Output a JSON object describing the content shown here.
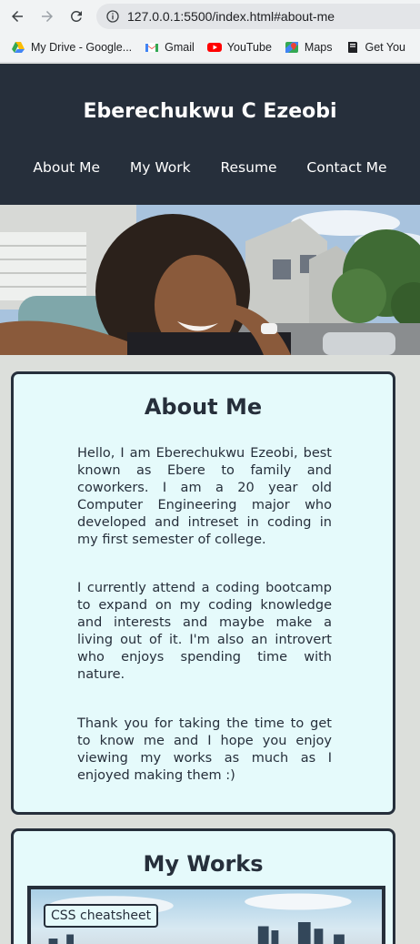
{
  "browser": {
    "url": "127.0.0.1:5500/index.html#about-me",
    "bookmarks": [
      {
        "label": "My Drive - Google...",
        "icon": "google-drive-icon"
      },
      {
        "label": "Gmail",
        "icon": "gmail-icon"
      },
      {
        "label": "YouTube",
        "icon": "youtube-icon"
      },
      {
        "label": "Maps",
        "icon": "maps-icon"
      },
      {
        "label": "Get You",
        "icon": "book-icon"
      }
    ]
  },
  "site": {
    "title": "Eberechukwu C Ezeobi",
    "nav": [
      "About Me",
      "My Work",
      "Resume",
      "Contact Me"
    ],
    "header_color": "#262f3b"
  },
  "about": {
    "heading": "About Me",
    "paragraphs": [
      "Hello, I am Eberechukwu Ezeobi, best known as Ebere to family and coworkers. I am a 20 year old Computer Engineering major who developed and intreset in coding in my first semester of college.",
      "I currently attend a coding bootcamp to expand on my coding knowledge and interests and maybe make a living out of it. I'm also an introvert who enjoys spending time with nature.",
      "Thank you for taking the time to get to know me and I hope you enjoy viewing my works as much as I enjoyed making them :)"
    ]
  },
  "works": {
    "heading": "My Works",
    "items": [
      {
        "label": "CSS cheatsheet"
      }
    ]
  }
}
